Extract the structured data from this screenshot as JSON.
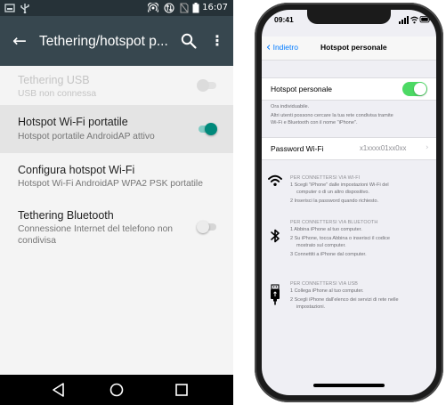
{
  "android": {
    "status_bar": {
      "time": "16:07",
      "icons": [
        "screenshot-icon",
        "usb-icon",
        "hotspot-icon",
        "data-arrows-icon",
        "no-sim-icon",
        "battery-icon"
      ]
    },
    "toolbar": {
      "title": "Tethering/hotspot p...",
      "icons": [
        "back-arrow-icon",
        "search-icon",
        "more-vert-icon"
      ]
    },
    "settings": [
      {
        "title": "Tethering USB",
        "subtitle": "USB non connessa",
        "toggle": "disabled"
      },
      {
        "title": "Hotspot Wi-Fi portatile",
        "subtitle": "Hotspot portatile AndroidAP attivo",
        "toggle": "on"
      },
      {
        "title": "Configura hotspot Wi-Fi",
        "subtitle": "Hotspot Wi-Fi AndroidAP WPA2 PSK portatile"
      },
      {
        "title": "Tethering Bluetooth",
        "subtitle_line1": "Connessione Internet del telefono non",
        "subtitle_line2": "condivisa",
        "toggle": "off"
      }
    ],
    "nav_bar": [
      "back-triangle-icon",
      "home-circle-icon",
      "recents-square-icon"
    ],
    "colors": {
      "accent": "#00897b",
      "toolbar": "#37474f",
      "status_bar": "#263238"
    }
  },
  "iphone": {
    "status_bar": {
      "time": "09:41"
    },
    "nav": {
      "back_label": "Indietro",
      "title": "Hotspot personale"
    },
    "hotspot_row": {
      "label": "Hotspot personale",
      "switch": "on"
    },
    "info": {
      "line1": "Ora individuabile.",
      "line2": "Altri utenti possono cercare la tua rete condivisa tramite",
      "line3": "Wi-Fi e Bluetooth con il nome \"iPhone\"."
    },
    "password_row": {
      "label": "Password Wi-Fi",
      "value": "x1xxxx01xx0xx"
    },
    "sections": [
      {
        "icon": "wifi-icon",
        "heading": "PER CONNETTERSI VIA WI-FI",
        "steps": [
          [
            "1 Scegli \"iPhone\" dalle impostazioni Wi-Fi del",
            "computer o di un altro dispositivo."
          ],
          [
            "2 Inserisci la password quando richiesto."
          ]
        ]
      },
      {
        "icon": "bluetooth-icon",
        "heading": "PER CONNETTERSI VIA BLUETOOTH",
        "steps": [
          [
            "1 Abbina iPhone al tuo computer."
          ],
          [
            "2 Su iPhone, tocca Abbina o inserisci il codice",
            "mostrato sul computer."
          ],
          [
            "3 Connettiti a iPhone dal computer."
          ]
        ]
      },
      {
        "icon": "usb-cable-icon",
        "heading": "PER CONNETTERSI VIA USB",
        "steps": [
          [
            "1 Collega iPhone al tuo computer."
          ],
          [
            "2 Scegli iPhone dall'elenco dei servizi di rete nelle",
            "impostazioni."
          ]
        ]
      }
    ],
    "colors": {
      "accent": "#007aff",
      "switch_on": "#4cd964",
      "background": "#efeff4"
    }
  }
}
